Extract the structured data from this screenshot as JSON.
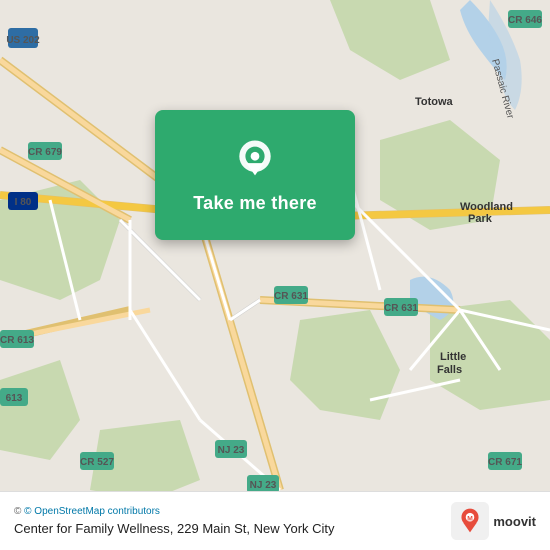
{
  "map": {
    "attribution": "© OpenStreetMap contributors",
    "osm_url": "#"
  },
  "overlay": {
    "button_label": "Take me there",
    "pin_icon": "location-pin"
  },
  "bottom_bar": {
    "location_name": "Center for Family Wellness, 229 Main St, New York City"
  },
  "moovit": {
    "logo_text": "moovit"
  }
}
